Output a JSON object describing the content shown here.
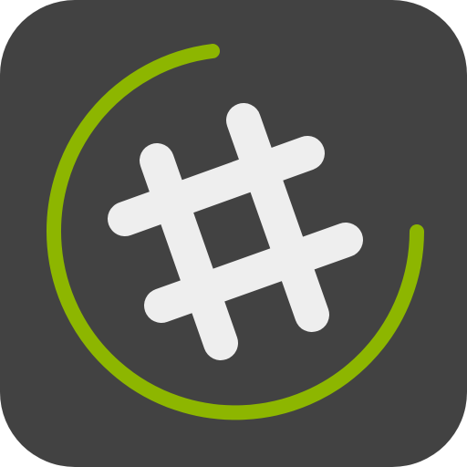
{
  "icon": {
    "subject": "hash-symbol-with-progress-ring",
    "colors": {
      "tile": "#424242",
      "hash": "#eeeeee",
      "ring": "#8db600"
    },
    "ring_progress": 0.83
  }
}
